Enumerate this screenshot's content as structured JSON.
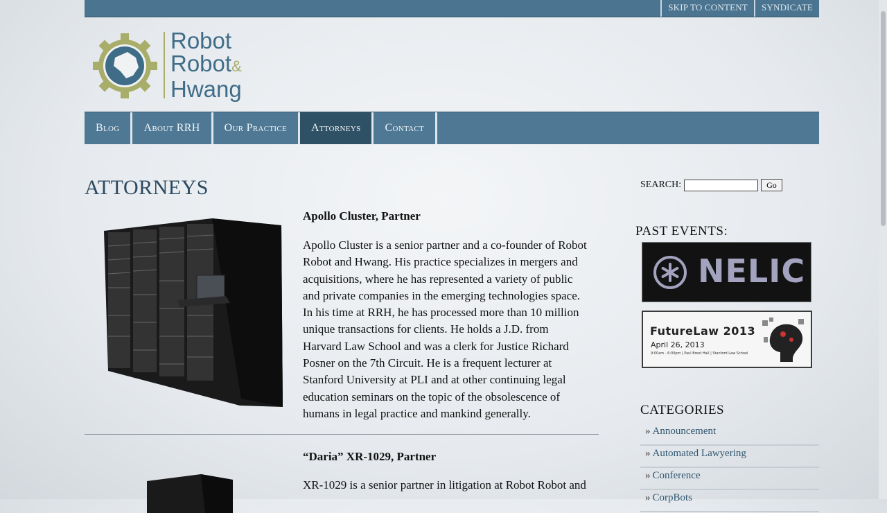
{
  "topbar": {
    "links": [
      "SKIP TO CONTENT",
      "SYNDICATE"
    ]
  },
  "logo": {
    "line1": "Robot",
    "line2": "Robot",
    "amp": "&",
    "line3": "Hwang"
  },
  "nav": {
    "items": [
      "Blog",
      "About RRH",
      "Our Practice",
      "Attorneys",
      "Contact"
    ],
    "active": "Attorneys"
  },
  "page": {
    "title": "ATTORNEYS"
  },
  "attorneys": [
    {
      "name": "Apollo Cluster, Partner",
      "bio_lines": [
        "Apollo Cluster is a senior partner and a co-founder of Robot",
        "Robot and Hwang. His practice specializes in mergers and",
        "acquisitions, where he has represented a variety of public",
        "and private companies in the emerging technologies space.",
        "In his time at RRH, he has processed more than 10 million",
        "unique transactions for clients. He holds a J.D. from",
        "Harvard Law School and was a clerk for Justice Richard",
        "Posner on the 7th Circuit. He is a frequent lecturer at",
        "Stanford University at PLI and at other continuing legal",
        "education seminars on the topic of the obsolescence of",
        "humans in legal practice and mankind generally."
      ]
    },
    {
      "name": "“Daria” XR-1029, Partner",
      "bio_lines": [
        "XR-1029 is a senior partner in litigation at Robot Robot and"
      ]
    }
  ],
  "sidebar": {
    "search_label": "SEARCH:",
    "search_value": "",
    "go_label": "Go",
    "past_events_heading": "PAST EVENTS:",
    "events": [
      {
        "name": "NELIC"
      },
      {
        "name": "FutureLaw 2013",
        "date": "April 26, 2013",
        "details": "9:00am - 6:00pm | Paul Brest Hall | Stanford Law School"
      }
    ],
    "categories_heading": "CATEGORIES",
    "categories": [
      "Announcement",
      "Automated Lawyering",
      "Conference",
      "CorpBots"
    ]
  },
  "colors": {
    "brand_blue": "#4e7894",
    "nav_active": "#2f5166",
    "logo_olive": "#a8ad6a",
    "title_blue": "#2d4a60"
  },
  "icons": [
    "gear-logo-icon",
    "nelic-asterisk-icon",
    "server-rack-image",
    "brain-robot-image"
  ]
}
